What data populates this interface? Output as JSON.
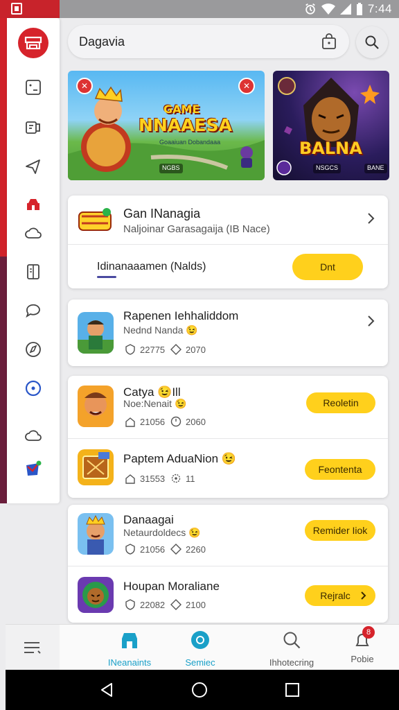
{
  "status_bar": {
    "time": "7:44"
  },
  "search": {
    "query": "Dagavia"
  },
  "banners": [
    {
      "title_line1": "GAME",
      "title_line2": "NNAAESA",
      "subtitle": "Goaaiuan Dobandaaa",
      "chip": "NGBS"
    },
    {
      "title": "BALNA",
      "chip1": "NSGCS",
      "chip2": "BANE"
    }
  ],
  "featured": {
    "title": "Gan INanagia",
    "subtitle": "Naljoinar Garasagaija (IB Nace)",
    "tab_label": "Idinanaaamen (Nalds)",
    "button": "Dnt"
  },
  "list": [
    {
      "title": "Rapenen Iehhaliddom",
      "sub": "Nednd Nanda",
      "emoji": "😉",
      "stat1": "22775",
      "stat2": "2070"
    },
    {
      "title": "Catya",
      "title_emoji": "😉",
      "title_suffix": "Ill",
      "sub": "Noe:Nenait",
      "emoji": "😉",
      "stat1": "21056",
      "stat2": "2060",
      "button": "Reoletin"
    },
    {
      "title": "Paptem AduaNion",
      "title_emoji": "😉",
      "stat1": "31553",
      "stat2": "11",
      "button": "Feontenta"
    },
    {
      "title": "Danaagai",
      "sub": "Netaurdoldecs",
      "emoji": "😉",
      "stat1": "21056",
      "stat2": "2260",
      "button": "Remider Iiok"
    },
    {
      "title": "Houpan Moraliane",
      "stat1": "22082",
      "stat2": "2100",
      "button": "Rejralc"
    }
  ],
  "bottom_nav": [
    {
      "label": "INeanaints",
      "color": "#1aa0c8"
    },
    {
      "label": "Semiec",
      "color": "#1aa0c8"
    },
    {
      "label": "Ihhotecring",
      "color": "#555555"
    },
    {
      "label": "Pobie",
      "badge": "8",
      "color": "#555555"
    }
  ],
  "colors": {
    "accent_red": "#d6232b",
    "accent_yellow": "#ffd01c",
    "accent_teal": "#1aa0c8"
  }
}
